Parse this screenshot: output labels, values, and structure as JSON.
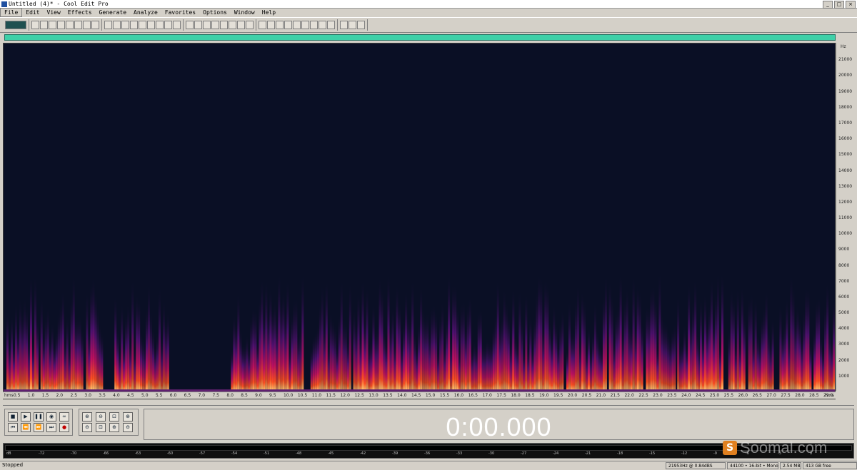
{
  "window": {
    "title": "Untitled (4)* - Cool Edit Pro"
  },
  "menu": [
    "File",
    "Edit",
    "View",
    "Effects",
    "Generate",
    "Analyze",
    "Favorites",
    "Options",
    "Window",
    "Help"
  ],
  "spectrogram": {
    "freq_unit": "Hz",
    "freq_labels": [
      "21000",
      "20000",
      "19000",
      "18000",
      "17000",
      "16000",
      "15000",
      "14000",
      "13000",
      "12000",
      "11000",
      "10000",
      "9000",
      "8000",
      "7000",
      "6000",
      "5000",
      "4000",
      "3000",
      "2000",
      "1000"
    ],
    "time_start_label": "hms",
    "time_end_label": "hms",
    "time_labels": [
      "0.5",
      "1.0",
      "1.5",
      "2.0",
      "2.5",
      "3.0",
      "3.5",
      "4.0",
      "4.5",
      "5.0",
      "5.5",
      "6.0",
      "6.5",
      "7.0",
      "7.5",
      "8.0",
      "8.5",
      "9.0",
      "9.5",
      "10.0",
      "10.5",
      "11.0",
      "11.5",
      "12.0",
      "12.5",
      "13.0",
      "13.5",
      "14.0",
      "14.5",
      "15.0",
      "15.5",
      "16.0",
      "16.5",
      "17.0",
      "17.5",
      "18.0",
      "18.5",
      "19.0",
      "19.5",
      "20.0",
      "20.5",
      "21.0",
      "21.5",
      "22.0",
      "22.5",
      "23.0",
      "23.5",
      "24.0",
      "24.5",
      "25.0",
      "25.5",
      "26.0",
      "26.5",
      "27.0",
      "27.5",
      "28.0",
      "28.5",
      "29.0"
    ],
    "duration_seconds": 29.3,
    "max_frequency_hz": 22050,
    "speech_segments_seconds": [
      [
        0.1,
        1.2
      ],
      [
        1.3,
        2.8
      ],
      [
        2.9,
        3.5
      ],
      [
        3.9,
        5.0
      ],
      [
        5.0,
        5.8
      ],
      [
        8.0,
        10.5
      ],
      [
        10.8,
        12.2
      ],
      [
        12.3,
        13.9
      ],
      [
        13.9,
        16.0
      ],
      [
        16.0,
        17.9
      ],
      [
        17.9,
        19.7
      ],
      [
        19.8,
        21.2
      ],
      [
        21.3,
        22.5
      ],
      [
        22.6,
        23.6
      ],
      [
        23.7,
        24.5
      ],
      [
        24.5,
        25.3
      ],
      [
        25.5,
        26.1
      ],
      [
        26.2,
        27.1
      ],
      [
        27.3,
        28.4
      ],
      [
        28.5,
        29.2
      ]
    ]
  },
  "transport": {
    "time": "0:00.000",
    "buttons": [
      "■",
      "▶",
      "❚❚",
      "◉",
      "∞",
      "⏮",
      "⏪",
      "⏩",
      "⏭",
      "●"
    ],
    "zoom_buttons": [
      "⊕",
      "⊖",
      "⊡",
      "⊕",
      "⊖",
      "⊡",
      "⊕",
      "⊖"
    ]
  },
  "level_meter": {
    "labels": [
      "dB",
      "-72",
      "-70",
      "-66",
      "-63",
      "-60",
      "-57",
      "-54",
      "-51",
      "-48",
      "-45",
      "-42",
      "-39",
      "-36",
      "-33",
      "-30",
      "-27",
      "-24",
      "-21",
      "-18",
      "-15",
      "-12",
      "-9",
      "-6",
      "-3",
      "0"
    ]
  },
  "watermark": {
    "text": "Soomal.com",
    "icon": "S"
  },
  "status": {
    "left": "Stopped",
    "cells": [
      "21953Hz @ 0.84dBS",
      "44100 • 16-bit • Mono",
      "2.54 MB",
      "413 GB free"
    ]
  },
  "colors": {
    "spectrogram_bg": "#0a0f25",
    "overview": "#3fd0a8",
    "chrome": "#d4d0c8"
  }
}
